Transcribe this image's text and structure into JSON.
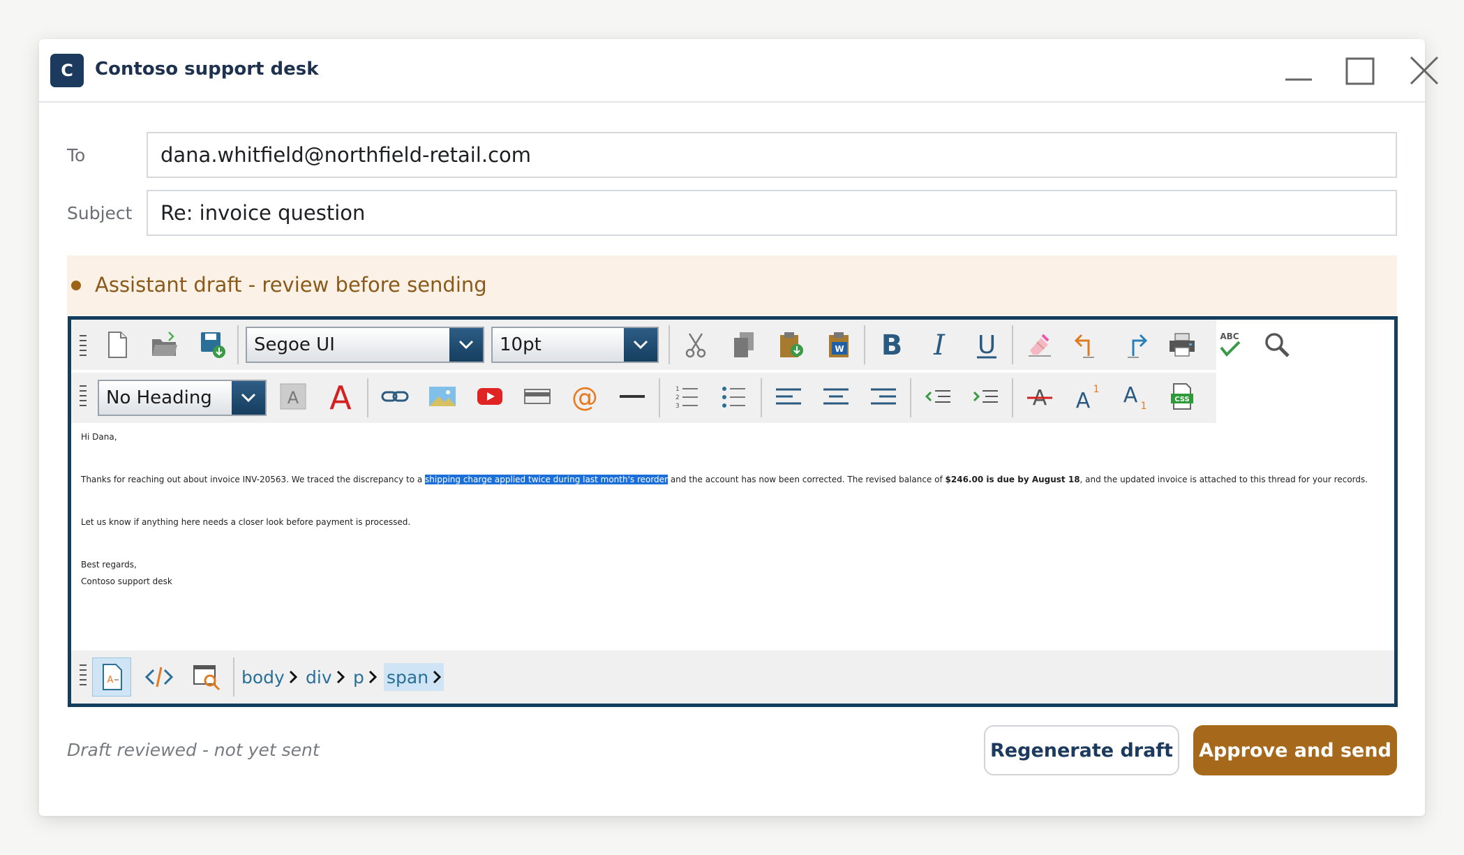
{
  "window": {
    "app_initial": "C",
    "title": "Contoso support desk"
  },
  "form": {
    "to_label": "To",
    "to_value": "dana.whitfield@northfield-retail.com",
    "subject_label": "Subject",
    "subject_value": "Re: invoice question"
  },
  "banner": {
    "text": "Assistant draft - review before sending"
  },
  "toolbar": {
    "font_name": "Segoe UI",
    "font_size": "10pt",
    "heading": "No Heading",
    "spellcheck_label": "ABC",
    "css_label": "CSS",
    "word_label": "W"
  },
  "body": {
    "greeting": "Hi Dana,",
    "p1_before": "Thanks for reaching out about invoice INV-20563. We traced the discrepancy to a ",
    "p1_selected": "shipping charge applied twice during last month's reorder",
    "p1_middle": " and the account has now been corrected. The revised balance of ",
    "p1_bold": "$246.00 is due by August 18",
    "p1_after": ", and the updated invoice is attached to this thread for your records.",
    "p2": "Let us know if anything here needs a closer look before payment is processed.",
    "closing": "Best regards,",
    "signature": "Contoso support desk"
  },
  "breadcrumb": [
    "body",
    "div",
    "p",
    "span"
  ],
  "footer": {
    "status": "Draft reviewed - not yet sent",
    "regenerate_label": "Regenerate draft",
    "approve_label": "Approve and send"
  },
  "colors": {
    "brand_navy": "#1c3a5e",
    "accent_amber": "#a6691c",
    "banner_bg": "#fbf1e6",
    "selection": "#1a6fd8"
  }
}
